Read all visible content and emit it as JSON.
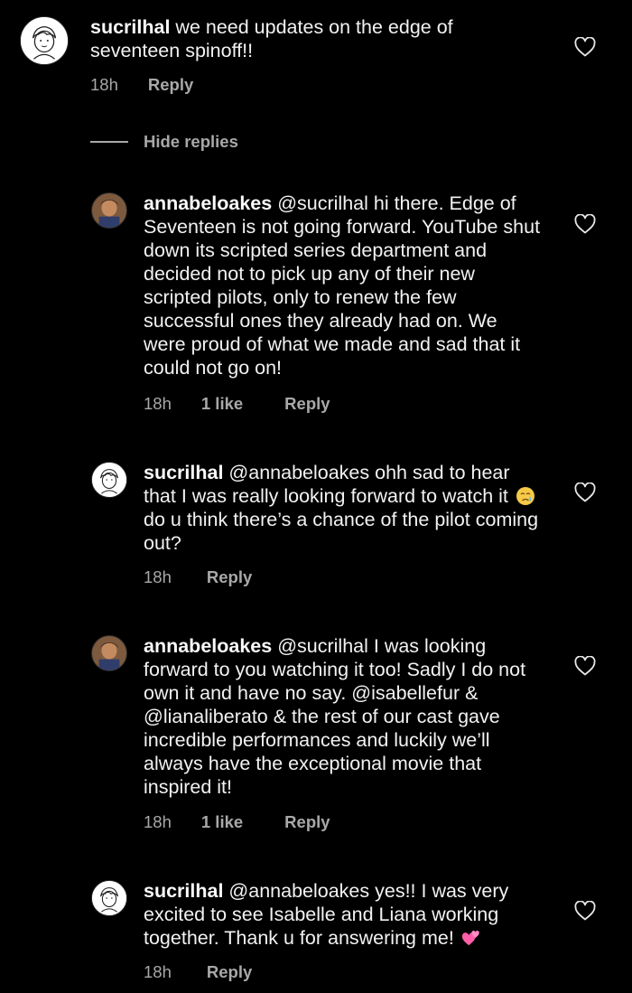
{
  "comments": [
    {
      "username": "sucrilhal",
      "text": "we need updates on the edge of seventeen spinoff!!",
      "time": "18h",
      "likes": "",
      "reply_label": "Reply"
    },
    {
      "username": "annabeloakes",
      "mention": "@sucrilhal",
      "text": "hi there. Edge of Seventeen is not going forward. YouTube shut down its scripted series department and decided not to pick up any of their new scripted pilots, only to renew the few successful ones they already had on. We were proud of what we made and sad that it could not go on!",
      "time": "18h",
      "likes": "1 like",
      "reply_label": "Reply"
    },
    {
      "username": "sucrilhal",
      "mention": "@annabeloakes",
      "text_before": "ohh sad to hear that I was really looking forward to watch it",
      "emoji": "crying-face-emoji",
      "text_after": "do u think there’s a chance of the pilot coming out?",
      "time": "18h",
      "likes": "",
      "reply_label": "Reply"
    },
    {
      "username": "annabeloakes",
      "mention": "@sucrilhal",
      "text": "I was looking forward to you watching it too! Sadly I do not own it and have no say. @isabellefur & @lianaliberato & the rest of our cast gave incredible performances and luckily we’ll always have the exceptional movie that inspired it!",
      "time": "18h",
      "likes": "1 like",
      "reply_label": "Reply"
    },
    {
      "username": "sucrilhal",
      "mention": "@annabeloakes",
      "text": "yes!! I was very excited to see Isabelle and Liana working together. Thank u for answering me!",
      "emoji": "two-hearts-emoji",
      "time": "18h",
      "likes": "",
      "reply_label": "Reply"
    }
  ],
  "hide_replies_label": "Hide replies",
  "colors": {
    "background": "#000000",
    "text": "#f2f2f2",
    "meta": "#a8a8a8",
    "emoji_heart": "#ff5fa8"
  }
}
